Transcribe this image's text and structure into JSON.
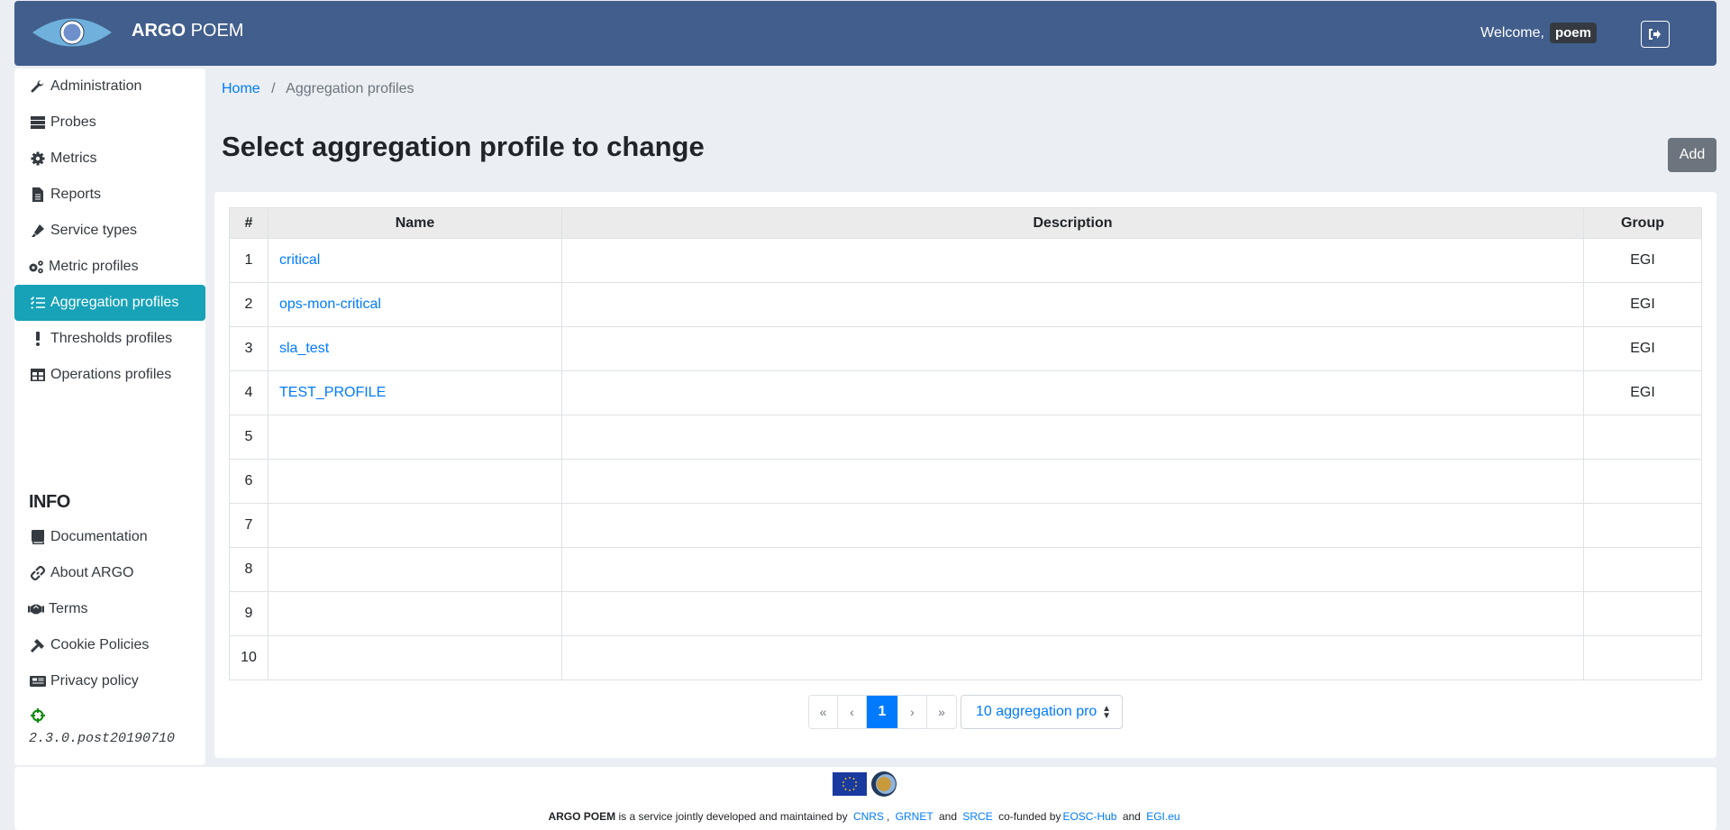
{
  "header": {
    "brand_bold": "ARGO",
    "brand_rest": "POEM",
    "welcome": "Welcome,",
    "username": "poem"
  },
  "sidebar": {
    "items": [
      {
        "label": "Administration",
        "icon": "wrench-icon"
      },
      {
        "label": "Probes",
        "icon": "server-icon"
      },
      {
        "label": "Metrics",
        "icon": "cog-icon"
      },
      {
        "label": "Reports",
        "icon": "file-icon"
      },
      {
        "label": "Service types",
        "icon": "highlighter-icon"
      },
      {
        "label": "Metric profiles",
        "icon": "cogs-icon"
      },
      {
        "label": "Aggregation profiles",
        "icon": "tasks-icon",
        "active": true
      },
      {
        "label": "Thresholds profiles",
        "icon": "exclamation-icon"
      },
      {
        "label": "Operations profiles",
        "icon": "table-icon"
      }
    ],
    "info_title": "INFO",
    "info_items": [
      {
        "label": "Documentation",
        "icon": "book-icon"
      },
      {
        "label": "About ARGO",
        "icon": "link-icon"
      },
      {
        "label": "Terms",
        "icon": "handshake-icon"
      },
      {
        "label": "Cookie Policies",
        "icon": "gavel-icon"
      },
      {
        "label": "Privacy policy",
        "icon": "newspaper-icon"
      }
    ],
    "version": "2.3.0.post20190710"
  },
  "breadcrumb": {
    "home": "Home",
    "separator": "/",
    "current": "Aggregation profiles"
  },
  "page": {
    "title": "Select aggregation profile to change",
    "add_label": "Add"
  },
  "table": {
    "headers": [
      "#",
      "Name",
      "Description",
      "Group"
    ],
    "rows": [
      {
        "num": "1",
        "name": "critical",
        "description": "",
        "group": "EGI"
      },
      {
        "num": "2",
        "name": "ops-mon-critical",
        "description": "",
        "group": "EGI"
      },
      {
        "num": "3",
        "name": "sla_test",
        "description": "",
        "group": "EGI"
      },
      {
        "num": "4",
        "name": "TEST_PROFILE",
        "description": "",
        "group": "EGI"
      },
      {
        "num": "5",
        "name": "",
        "description": "",
        "group": ""
      },
      {
        "num": "6",
        "name": "",
        "description": "",
        "group": ""
      },
      {
        "num": "7",
        "name": "",
        "description": "",
        "group": ""
      },
      {
        "num": "8",
        "name": "",
        "description": "",
        "group": ""
      },
      {
        "num": "9",
        "name": "",
        "description": "",
        "group": ""
      },
      {
        "num": "10",
        "name": "",
        "description": "",
        "group": ""
      }
    ]
  },
  "pagination": {
    "first": "«",
    "prev": "‹",
    "current": "1",
    "next": "›",
    "last": "»",
    "page_size": "10 aggregation pro"
  },
  "footer": {
    "brand": "ARGO POEM",
    "text1": "is a service jointly developed and maintained by",
    "cnrs": "CNRS",
    "comma": ",",
    "grnet": "GRNET",
    "and1": "and",
    "srce": "SRCE",
    "text2": "co-funded by",
    "eosc": "EOSC-Hub",
    "and2": "and",
    "egi": "EGI.eu"
  },
  "colors": {
    "header_bg": "#415e8c",
    "active_nav": "#17a2b8",
    "link": "#007bff",
    "add_button": "#6c757d"
  }
}
